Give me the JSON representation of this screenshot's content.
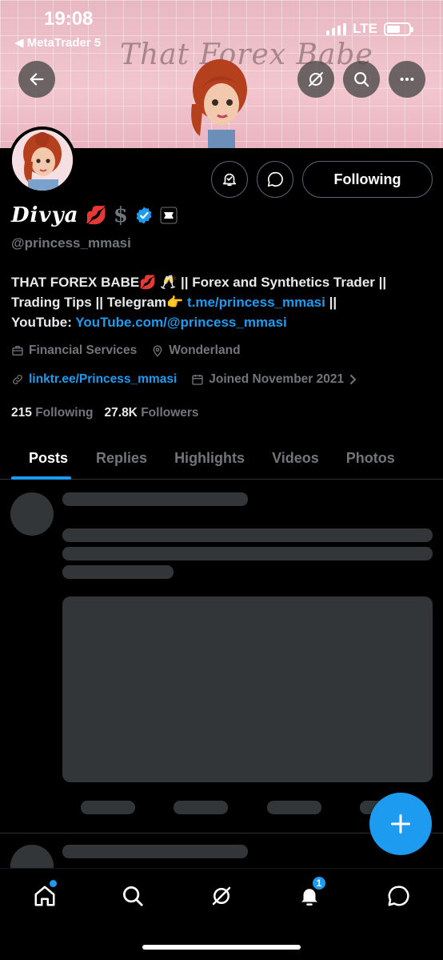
{
  "status_bar": {
    "time": "19:08",
    "back_app": "◀ MetaTrader 5",
    "network": "LTE"
  },
  "banner": {
    "title": "That Forex Babe"
  },
  "actions": {
    "following_label": "Following"
  },
  "profile": {
    "name": "Divya",
    "name_emoji": "💋",
    "name_symbol": "$",
    "handle": "@princess_mmasi",
    "bio_line1": "THAT FOREX BABE💋 🥂 || Forex and Synthetics Trader ||",
    "bio_line2_text": "Trading Tips || Telegram👉 ",
    "bio_line2_link": "t.me/princess_mmasi",
    "bio_line2_suffix": " ||",
    "bio_line3_text": "YouTube: ",
    "bio_line3_link": "YouTube.com/@princess_mmasi",
    "category": "Financial Services",
    "location": "Wonderland",
    "website": "linktr.ee/Princess_mmasi",
    "joined": "Joined November 2021",
    "following_count": "215",
    "following_label": "Following",
    "followers_count": "27.8K",
    "followers_label": "Followers"
  },
  "tabs": [
    {
      "label": "Posts",
      "active": true
    },
    {
      "label": "Replies"
    },
    {
      "label": "Highlights"
    },
    {
      "label": "Videos"
    },
    {
      "label": "Photos"
    }
  ],
  "nav": {
    "notification_badge": "1"
  },
  "icons": [
    "back-arrow-icon",
    "grok-icon",
    "search-icon",
    "more-icon",
    "notify-bell-icon",
    "message-icon",
    "verified-badge-icon",
    "briefcase-icon",
    "location-pin-icon",
    "link-icon",
    "calendar-icon",
    "chevron-right-icon",
    "compose-plus-icon",
    "home-icon",
    "explore-icon",
    "grok-nav-icon",
    "notifications-icon",
    "messages-nav-icon"
  ],
  "colors": {
    "accent": "#1d9bf0",
    "muted": "#71767b",
    "background": "#000000"
  }
}
